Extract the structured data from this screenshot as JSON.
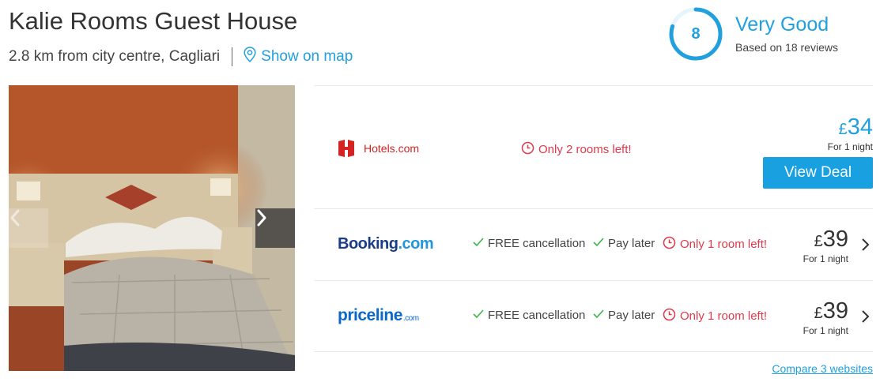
{
  "hotel": {
    "name": "Kalie Rooms Guest House",
    "distance": "2.8 km from city centre, Cagliari",
    "map_link": "Show on map"
  },
  "rating": {
    "score": "8",
    "score_fraction": 0.8,
    "label": "Very Good",
    "reviews": "Based on 18 reviews"
  },
  "deals": [
    {
      "provider": "Hotels.com",
      "availability": "Only 2 rooms left!",
      "currency": "£",
      "price": "34",
      "per_night": "For 1 night",
      "cta": "View Deal"
    },
    {
      "provider_part1": "Booking",
      "provider_part2": ".com",
      "feature1": "FREE cancellation",
      "feature2": "Pay later",
      "availability": "Only 1 room left!",
      "currency": "£",
      "price": "39",
      "per_night": "For 1 night"
    },
    {
      "provider": "priceline",
      "provider_suffix": ".com",
      "feature1": "FREE cancellation",
      "feature2": "Pay later",
      "availability": "Only 1 room left!",
      "currency": "£",
      "price": "39",
      "per_night": "For 1 night"
    }
  ],
  "compare_link": "Compare 3 websites",
  "colors": {
    "accent": "#21a0df",
    "alert": "#e0394a",
    "check": "#3cb54a",
    "button": "#19a0e1"
  },
  "icons": [
    "map-pin-icon",
    "clock-icon",
    "check-icon",
    "chevron-right-icon",
    "chevron-left-icon"
  ]
}
